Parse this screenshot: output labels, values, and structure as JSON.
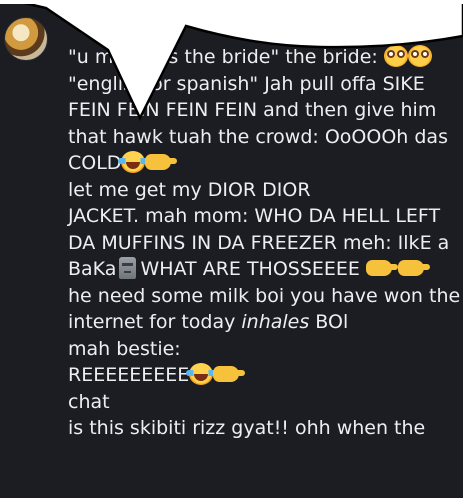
{
  "message": {
    "lines": [
      {
        "text": "\"u may kiss the bride\" the bride: "
      },
      {
        "text": "\"english or spanish\" Jah pull offa SIKE"
      },
      {
        "text": "FEIN FEIN FEIN FEIN and then give him"
      },
      {
        "text": "that hawk tuah the crowd: OoOOOh das"
      },
      {
        "text": "COLD"
      },
      {
        "text": "let me get my DIOR DIOR"
      },
      {
        "text": "JACKET. mah mom: WHO DA HELL LEFT"
      },
      {
        "text": "DA MUFFINS IN DA FREEZER meh: IlkE a"
      },
      {
        "a": "BaKa",
        "b": "WHAT ARE THOSSEEEE "
      },
      {
        "text": "he need some milk boi you have won the"
      },
      {
        "a": "internet for today ",
        "italic": "inhales",
        "b": " BOl"
      },
      {
        "text": "mah bestie:"
      },
      {
        "text": "REEEEEEEEE"
      },
      {
        "text": "chat"
      },
      {
        "text": "is this skibiti rizz gyat!! ohh when the"
      }
    ]
  },
  "icons": {
    "avatar": "avatar-image",
    "flushed": "flushed-face-emoji",
    "joy": "face-with-tears-of-joy-emoji",
    "point": "backhand-index-pointing-right-emoji",
    "moai": "moai-emoji"
  },
  "colors": {
    "background": "#1c1d22",
    "text": "#eceef1",
    "bubble": "#ffffff"
  }
}
